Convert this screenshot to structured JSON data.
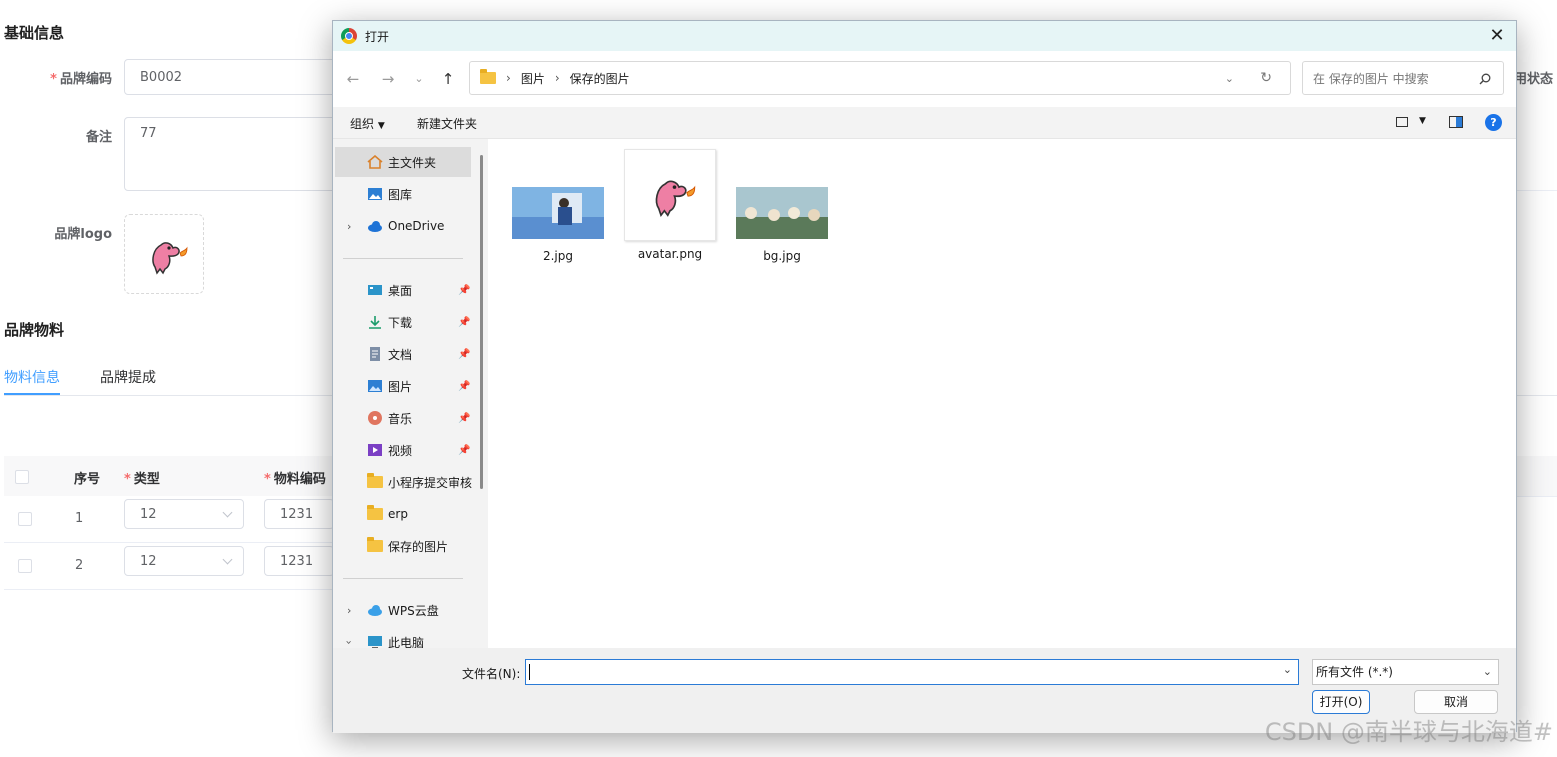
{
  "form": {
    "basic_title": "基础信息",
    "brand_code_label": "品牌编码",
    "brand_code_value": "B0002",
    "remark_label": "备注",
    "remark_value": "77",
    "logo_label": "品牌logo",
    "status_label_partial": "用状态",
    "materials_title": "品牌物料",
    "tabs": [
      "物料信息",
      "品牌提成"
    ],
    "table": {
      "headers": [
        "序号",
        "类型",
        "物料编码"
      ],
      "rows": [
        {
          "index": "1",
          "type": "12",
          "code": "1231"
        },
        {
          "index": "2",
          "type": "12",
          "code": "1231"
        }
      ]
    }
  },
  "dialog": {
    "title": "打开",
    "close": "✕",
    "breadcrumb": [
      "图片",
      "保存的图片"
    ],
    "search_placeholder": "在 保存的图片 中搜索",
    "toolbar": {
      "organize": "组织",
      "new_folder": "新建文件夹"
    },
    "sidebar": {
      "home": "主文件夹",
      "gallery": "图库",
      "onedrive": "OneDrive",
      "desktop": "桌面",
      "downloads": "下载",
      "documents": "文档",
      "pictures": "图片",
      "music": "音乐",
      "videos": "视频",
      "mini_program": "小程序提交审核",
      "erp": "erp",
      "saved_pictures": "保存的图片",
      "wps": "WPS云盘",
      "this_pc": "此电脑"
    },
    "files": [
      {
        "name": "2.jpg"
      },
      {
        "name": "avatar.png"
      },
      {
        "name": "bg.jpg"
      }
    ],
    "filename_label": "文件名(N):",
    "filename_value": "",
    "filetype": "所有文件 (*.*)",
    "open_button": "打开(O)",
    "cancel_button": "取消"
  },
  "watermark": "CSDN @南半球与北海道#",
  "colors": {
    "accent": "#409eff",
    "required": "#f56c6c",
    "dialog_title_bg": "#e6f5f6"
  }
}
